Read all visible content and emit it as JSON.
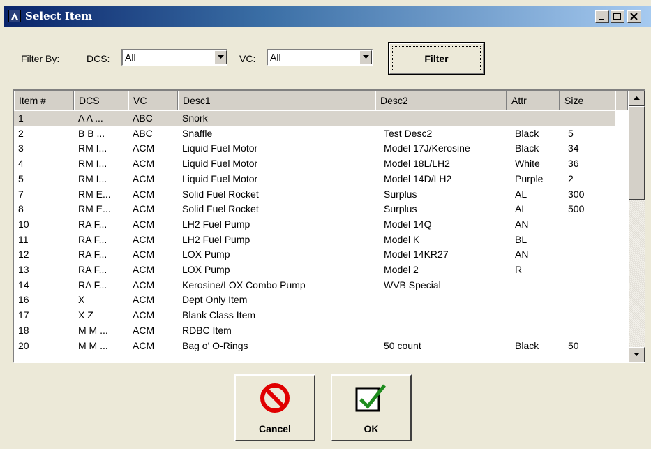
{
  "window": {
    "title": "Select Item",
    "icon": "app-icon",
    "controls": [
      "minimize",
      "maximize",
      "close"
    ]
  },
  "filters": {
    "filter_by_label": "Filter By:",
    "dcs_label": "DCS:",
    "dcs_value": "All",
    "vc_label": "VC:",
    "vc_value": "All",
    "filter_button": "Filter"
  },
  "table": {
    "columns": [
      "Item #",
      "DCS",
      "VC",
      "Desc1",
      "Desc2",
      "Attr",
      "Size"
    ],
    "selected_row": 0,
    "rows": [
      [
        "1",
        "A  A  ...",
        "ABC",
        "Snork",
        "",
        "",
        ""
      ],
      [
        "2",
        "B  B  ...",
        "ABC",
        "Snaffle",
        "Test Desc2",
        "Black",
        "5"
      ],
      [
        "3",
        "RM I...",
        "ACM",
        "Liquid Fuel Motor",
        "Model 17J/Kerosine",
        "Black",
        "34"
      ],
      [
        "4",
        "RM I...",
        "ACM",
        "Liquid Fuel Motor",
        "Model 18L/LH2",
        "White",
        "36"
      ],
      [
        "5",
        "RM I...",
        "ACM",
        "Liquid Fuel Motor",
        "Model 14D/LH2",
        "Purple",
        "2"
      ],
      [
        "7",
        "RM E...",
        "ACM",
        "Solid Fuel Rocket",
        "Surplus",
        "AL",
        "300"
      ],
      [
        "8",
        "RM E...",
        "ACM",
        "Solid Fuel Rocket",
        "Surplus",
        "AL",
        "500"
      ],
      [
        "10",
        "RA F...",
        "ACM",
        "LH2 Fuel Pump",
        "Model 14Q",
        "AN",
        ""
      ],
      [
        "11",
        "RA F...",
        "ACM",
        "LH2 Fuel Pump",
        "Model K",
        "BL",
        ""
      ],
      [
        "12",
        "RA F...",
        "ACM",
        "LOX Pump",
        "Model 14KR27",
        "AN",
        ""
      ],
      [
        "13",
        "RA F...",
        "ACM",
        "LOX Pump",
        "Model 2",
        "R",
        ""
      ],
      [
        "14",
        "RA F...",
        "ACM",
        "Kerosine/LOX Combo Pump",
        "WVB Special",
        "",
        ""
      ],
      [
        "16",
        "X",
        "ACM",
        "Dept Only Item",
        "",
        "",
        ""
      ],
      [
        "17",
        "X    Z",
        "ACM",
        "Blank Class Item",
        "",
        "",
        ""
      ],
      [
        "18",
        "M  M  ...",
        "ACM",
        "RDBC Item",
        "",
        "",
        ""
      ],
      [
        "20",
        "M  M  ...",
        "ACM",
        "Bag o' O-Rings",
        "50 count",
        "Black",
        "50"
      ]
    ]
  },
  "buttons": {
    "cancel": "Cancel",
    "ok": "OK"
  },
  "icons": {
    "cancel": "prohibited-icon",
    "ok": "checkbox-checked-icon"
  }
}
